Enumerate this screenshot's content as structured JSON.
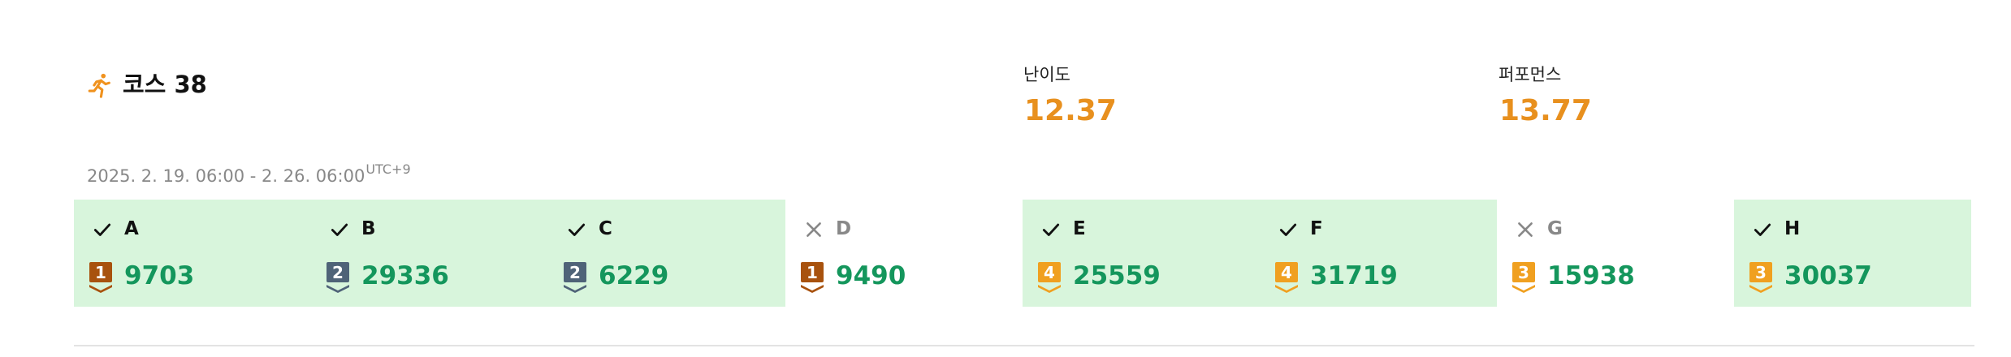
{
  "course": {
    "title": "코스 38",
    "icon": "running-person-icon",
    "date_range": "2025. 2. 19. 06:00 - 2. 26. 06:00",
    "timezone": "UTC+9"
  },
  "stats": {
    "difficulty_label": "난이도",
    "difficulty_value": "12.37",
    "performance_label": "퍼포먼스",
    "performance_value": "13.77"
  },
  "colors": {
    "pass_background": "#d8f5dc",
    "score": "#14965c",
    "stat_value": "#e8901e",
    "tier_1": "#a8520e",
    "tier_2": "#4f6378",
    "tier_3_4": "#f0a020"
  },
  "songs": [
    {
      "name": "A",
      "passed": true,
      "level": "1",
      "score": "9703"
    },
    {
      "name": "B",
      "passed": true,
      "level": "2",
      "score": "29336"
    },
    {
      "name": "C",
      "passed": true,
      "level": "2",
      "score": "6229"
    },
    {
      "name": "D",
      "passed": false,
      "level": "1",
      "score": "9490"
    },
    {
      "name": "E",
      "passed": true,
      "level": "4",
      "score": "25559"
    },
    {
      "name": "F",
      "passed": true,
      "level": "4",
      "score": "31719"
    },
    {
      "name": "G",
      "passed": false,
      "level": "3",
      "score": "15938"
    },
    {
      "name": "H",
      "passed": true,
      "level": "3",
      "score": "30037"
    }
  ]
}
